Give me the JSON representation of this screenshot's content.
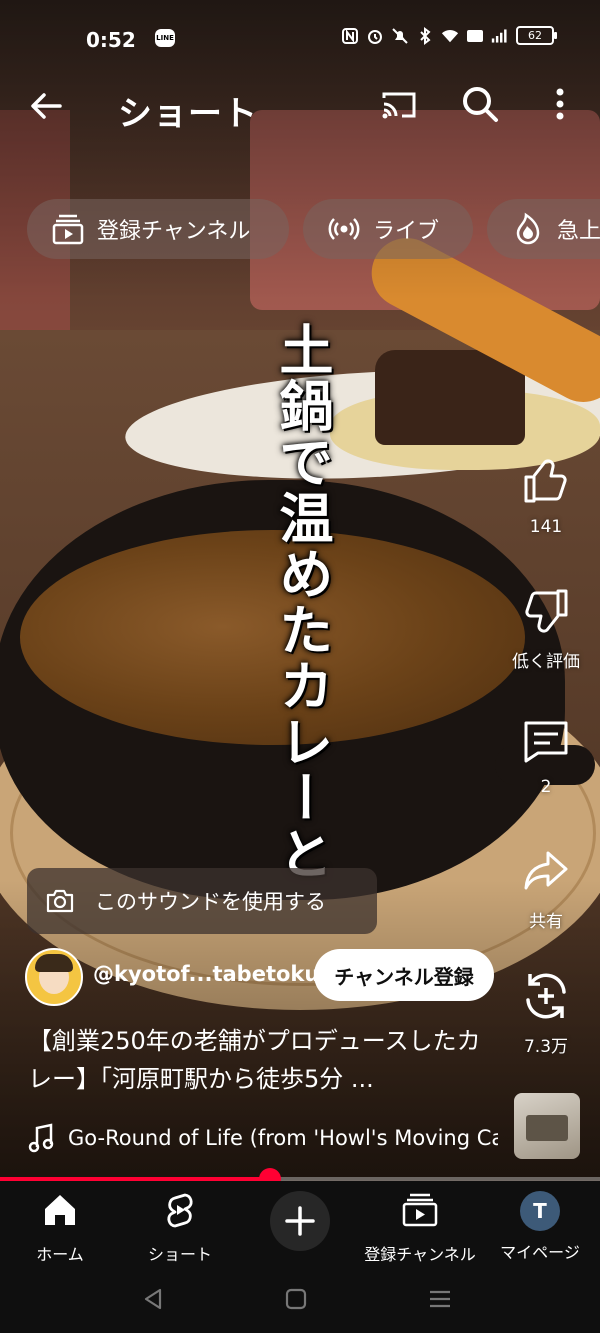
{
  "status_bar": {
    "time": "0:52",
    "line_badge": "LINE",
    "battery": "62"
  },
  "header": {
    "title": "ショート"
  },
  "chips": [
    {
      "label": "登録チャンネル",
      "icon": "subscriptions-icon"
    },
    {
      "label": "ライブ",
      "icon": "live-icon"
    },
    {
      "label": "急上",
      "icon": "trending-icon"
    }
  ],
  "overlay_text": "土鍋で温めたカレーと",
  "actions": {
    "like_count": "141",
    "dislike_label": "低く評価",
    "comment_count": "2",
    "share_label": "共有",
    "remix_count": "7.3万"
  },
  "sound_pill": "このサウンドを使用する",
  "channel": {
    "handle": "@kyotof...tabetoku",
    "subscribe_label": "チャンネル登録"
  },
  "description": "【創業250年の老舗がプロデュースしたカレー】「河原町駅から徒歩5分 ...",
  "music": "Go-Round of Life (from 'Howl's Moving Ca",
  "progress": 0.45,
  "bottom_nav": [
    {
      "label": "ホーム",
      "icon": "home-icon"
    },
    {
      "label": "ショート",
      "icon": "shorts-icon"
    },
    {
      "label": "",
      "icon": "plus-icon"
    },
    {
      "label": "登録チャンネル",
      "icon": "subscriptions-icon"
    },
    {
      "label": "マイページ",
      "icon": "avatar-icon",
      "avatar_letter": "T"
    }
  ],
  "colors": {
    "accent": "#ff0033",
    "nav_bg": "#0f0f0f",
    "subscribe_bg": "#ffffff"
  }
}
